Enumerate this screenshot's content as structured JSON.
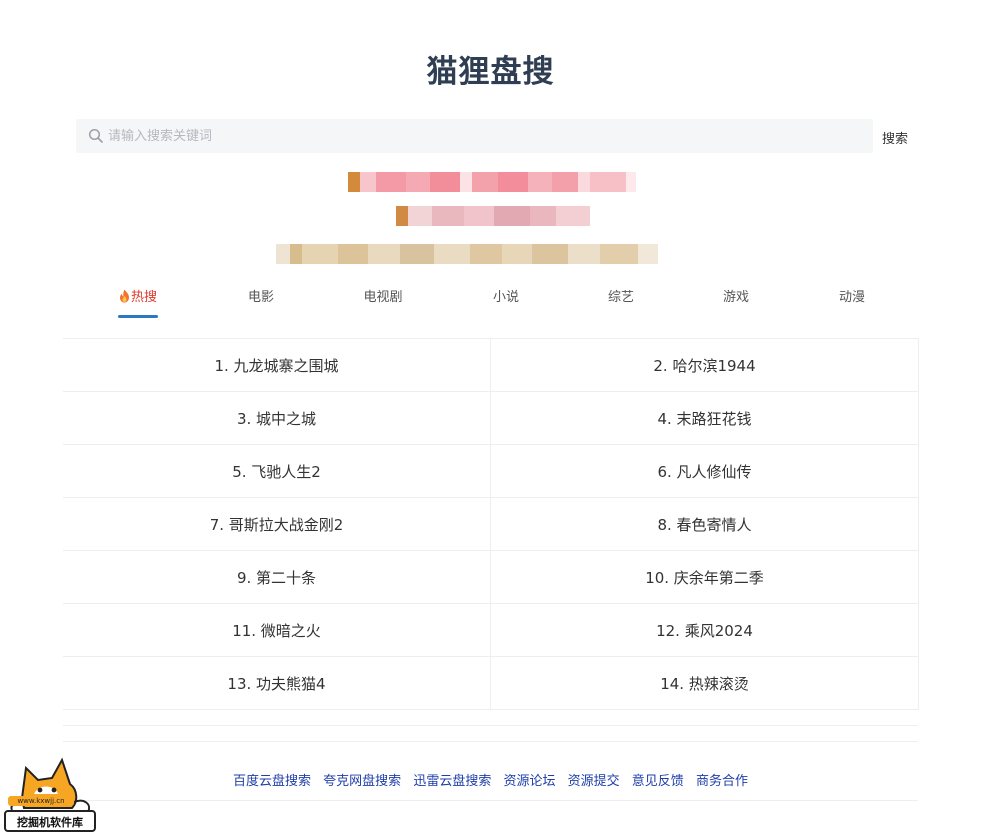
{
  "header": {
    "title": "猫狸盘搜"
  },
  "search": {
    "placeholder": "请输入搜索关键词",
    "value": "",
    "button_label": "搜索"
  },
  "tabs": [
    {
      "label": "热搜",
      "active": true,
      "icon": "fire-icon"
    },
    {
      "label": "电影",
      "active": false
    },
    {
      "label": "电视剧",
      "active": false
    },
    {
      "label": "小说",
      "active": false
    },
    {
      "label": "综艺",
      "active": false
    },
    {
      "label": "游戏",
      "active": false
    },
    {
      "label": "动漫",
      "active": false
    }
  ],
  "hot_list": [
    "1. 九龙城寨之围城",
    "2. 哈尔滨1944",
    "3. 城中之城",
    "4. 末路狂花钱",
    "5. 飞驰人生2",
    "6. 凡人修仙传",
    "7. 哥斯拉大战金刚2",
    "8. 春色寄情人",
    "9. 第二十条",
    "10. 庆余年第二季",
    "11. 微暗之火",
    "12. 乘风2024",
    "13. 功夫熊猫4",
    "14. 热辣滚烫"
  ],
  "footer": {
    "links": [
      "百度云盘搜索",
      "夸克网盘搜索",
      "迅雷云盘搜索",
      "资源论坛",
      "资源提交",
      "意见反馈",
      "商务合作"
    ]
  },
  "watermark": {
    "url": "www.kxwjj.cn",
    "text": "挖掘机软件库"
  },
  "colors": {
    "title": "#2f3e52",
    "active_tab": "#e03b2c",
    "tab_underline": "#2a79c2",
    "footer_link": "#1f3ea8",
    "search_bg": "#f5f6f8"
  }
}
